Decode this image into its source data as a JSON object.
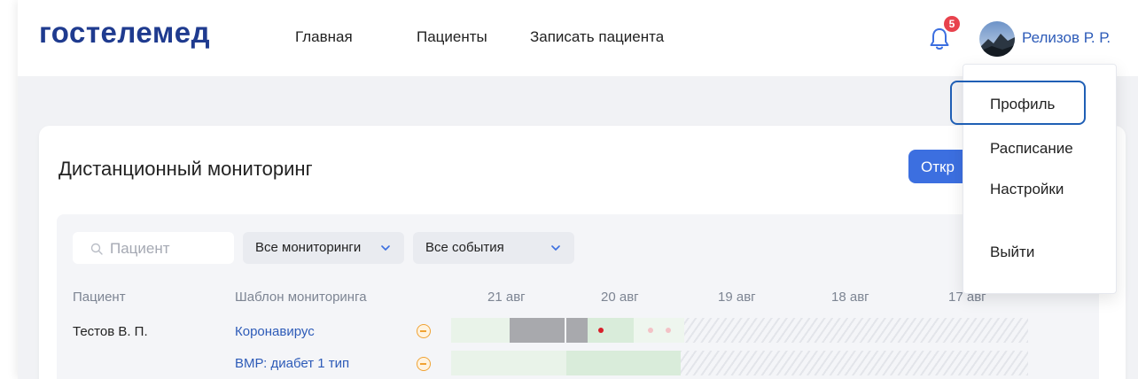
{
  "header": {
    "logo": "гостелемед",
    "nav": [
      "Главная",
      "Пациенты",
      "Записать пациента"
    ],
    "notifications_count": "5",
    "user_name": "Релизов Р. Р."
  },
  "user_menu": {
    "items": [
      "Профиль",
      "Расписание",
      "Настройки",
      "Выйти"
    ],
    "focused_item": "Профиль"
  },
  "monitoring": {
    "title": "Дистанционный мониторинг",
    "open_button_label": "Откр",
    "search_placeholder": "Пациент",
    "filters": [
      "Все мониторинги",
      "Все события"
    ],
    "columns": [
      "Пациент",
      "Шаблон мониторинга"
    ],
    "dates": [
      "21 авг",
      "20 авг",
      "19 авг",
      "18 авг",
      "17 авг"
    ],
    "rows": [
      {
        "patient": "Тестов В. П.",
        "template": "Коронавирус"
      },
      {
        "patient": "",
        "template": "ВМР: диабет 1 тип"
      }
    ]
  },
  "colors": {
    "brand": "#1f3b8f",
    "link": "#2d5bb8",
    "primary_button": "#3c6fe0",
    "badge": "#e8424d",
    "focus_ring": "#1f5fb5",
    "warning": "#f0a233",
    "event_red": "#d81f2a"
  },
  "icons": {
    "bell": "bell-icon",
    "search": "search-icon",
    "chevron": "chevron-down-icon",
    "remove": "minus-circle-icon"
  }
}
